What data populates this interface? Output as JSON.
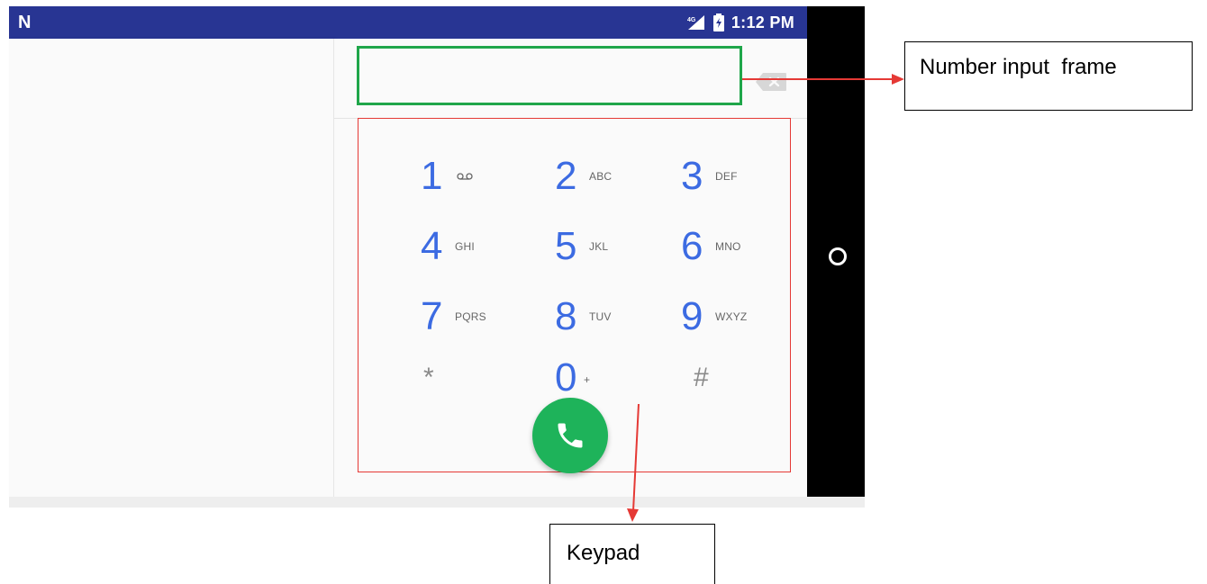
{
  "status_bar": {
    "notification_letter": "N",
    "network": "4G",
    "time": "1:12 PM",
    "color": "#283593"
  },
  "dialer": {
    "number_input_value": "",
    "keys": [
      {
        "digit": "1",
        "letters": "",
        "sub_icon": "voicemail-icon"
      },
      {
        "digit": "2",
        "letters": "ABC"
      },
      {
        "digit": "3",
        "letters": "DEF"
      },
      {
        "digit": "4",
        "letters": "GHI"
      },
      {
        "digit": "5",
        "letters": "JKL"
      },
      {
        "digit": "6",
        "letters": "MNO"
      },
      {
        "digit": "7",
        "letters": "PQRS"
      },
      {
        "digit": "8",
        "letters": "TUV"
      },
      {
        "digit": "9",
        "letters": "WXYZ"
      },
      {
        "digit": "*",
        "letters": ""
      },
      {
        "digit": "0",
        "letters": "+"
      },
      {
        "digit": "#",
        "letters": ""
      }
    ],
    "digit_color": "#3c6be2",
    "call_button_color": "#1eb35a",
    "icons": [
      "backspace-icon",
      "phone-icon",
      "home-button-icon"
    ]
  },
  "annotations": {
    "number_input_label": "Number input  frame",
    "keypad_label": "Keypad",
    "number_frame_color": "#1fa64a",
    "keypad_frame_color": "#e53935",
    "arrow_color": "#e53935"
  }
}
